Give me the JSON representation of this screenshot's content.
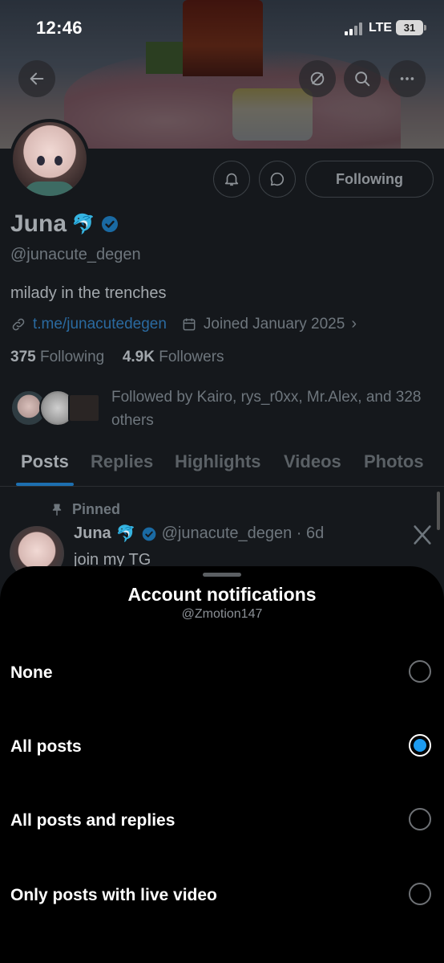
{
  "status_bar": {
    "time": "12:46",
    "network": "LTE",
    "battery": "31"
  },
  "profile": {
    "name": "Juna",
    "name_emoji": "🐬",
    "handle": "@junacute_degen",
    "bio": "milady in the trenches",
    "link": "t.me/junacutedegen",
    "joined": "Joined January 2025",
    "following_count": "375",
    "following_label": "Following",
    "followers_count": "4.9K",
    "followers_label": "Followers",
    "followed_by": "Followed by Kairo, rys_r0xx, Mr.Alex, and 328 others",
    "follow_button": "Following"
  },
  "tabs": [
    {
      "label": "Posts",
      "active": true
    },
    {
      "label": "Replies",
      "active": false
    },
    {
      "label": "Highlights",
      "active": false
    },
    {
      "label": "Videos",
      "active": false
    },
    {
      "label": "Photos",
      "active": false
    }
  ],
  "pinned_post": {
    "pinned_label": "Pinned",
    "author": "Juna",
    "author_emoji": "🐬",
    "handle_time": "@junacute_degen · 6d",
    "text": "join my TG"
  },
  "sheet": {
    "title": "Account notifications",
    "subtitle": "@Zmotion147",
    "options": [
      {
        "label": "None",
        "selected": false
      },
      {
        "label": "All posts",
        "selected": true
      },
      {
        "label": "All posts and replies",
        "selected": false
      },
      {
        "label": "Only posts with live video",
        "selected": false
      }
    ]
  },
  "colors": {
    "accent": "#1d9bf0",
    "sheet_bg": "#000000",
    "verified": "#1d9bf0"
  }
}
